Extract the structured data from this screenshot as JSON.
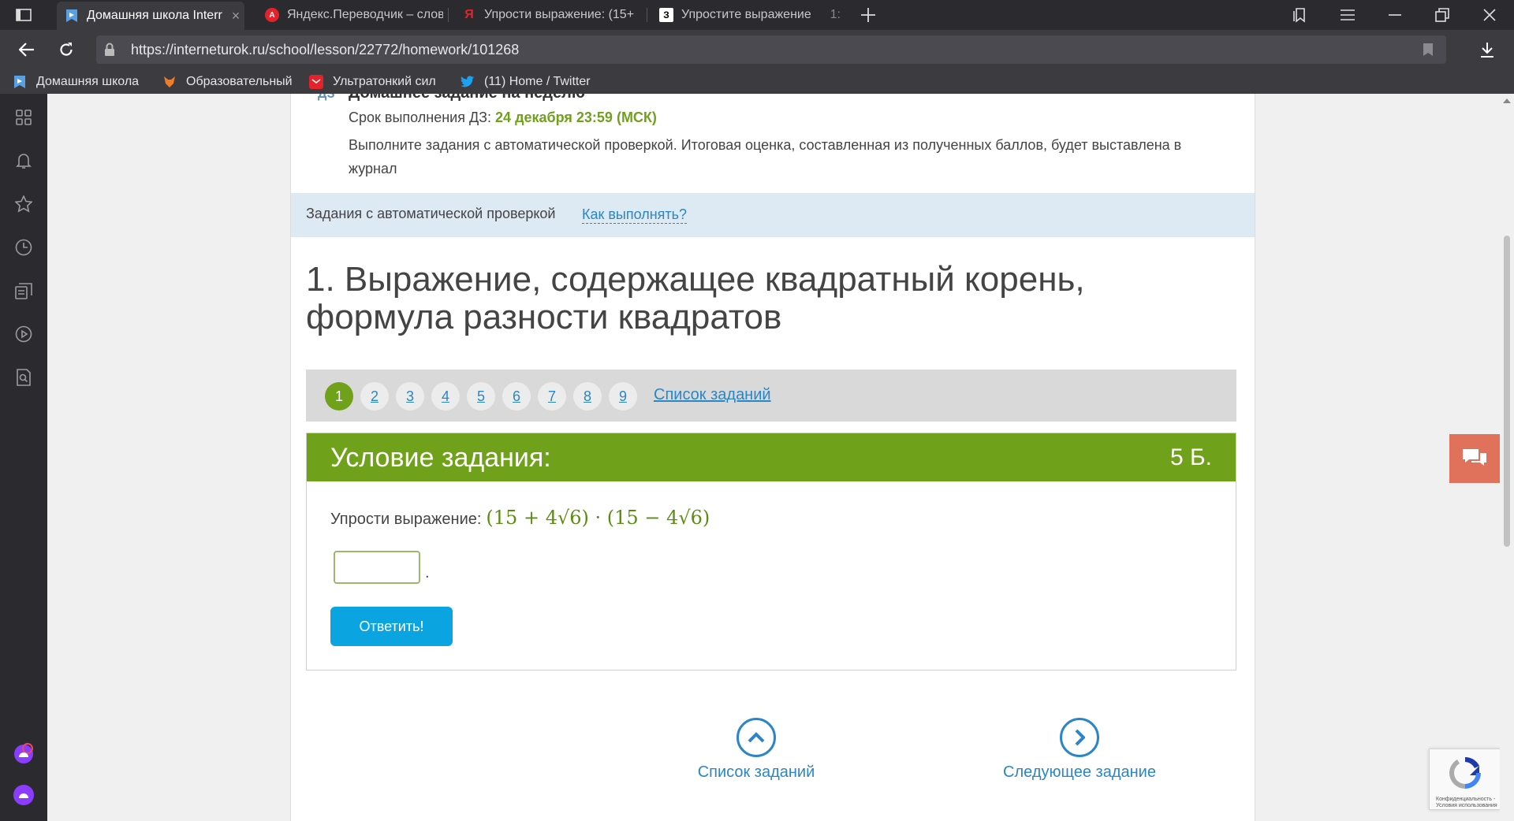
{
  "browser": {
    "tabs": [
      {
        "label": "Домашняя школа Interr",
        "active": true,
        "favicon": "interneturok"
      },
      {
        "label": "Яндекс.Переводчик – слов",
        "active": false,
        "favicon": "yandex-translate"
      },
      {
        "label": "Упрости выражение: (15+",
        "active": false,
        "favicon": "yandex"
      },
      {
        "label": "Упростите выражение",
        "active": false,
        "favicon": "znanija"
      }
    ],
    "tab_close": "×",
    "tab4_extra": "1:",
    "znanija_letter": "З",
    "yandex_letter": "Я",
    "url": "https://interneturok.ru/school/lesson/22772/homework/101268",
    "bookmarks": [
      {
        "label": "Домашняя школа"
      },
      {
        "label": "Образовательный"
      },
      {
        "label": "Ультратонкий сил"
      },
      {
        "label": "(11) Home / Twitter"
      }
    ]
  },
  "homework": {
    "badge": "ДЗ",
    "title": "Домашнее задание на неделю",
    "deadline_label": "Срок выполнения ДЗ:",
    "deadline_value": "24 декабря 23:59 (МСК)",
    "description": "Выполните задания с автоматической проверкой. Итоговая оценка, составленная из полученных баллов, будет выставлена в журнал"
  },
  "autobar": {
    "text": "Задания с автоматической проверкой",
    "link": "Как выполнять?"
  },
  "lesson": {
    "title": "1. Выражение, содержащее квадратный корень, формула разности квадратов"
  },
  "pager": {
    "pages": [
      "1",
      "2",
      "3",
      "4",
      "5",
      "6",
      "7",
      "8",
      "9"
    ],
    "active": "1",
    "list_link": "Список заданий"
  },
  "task": {
    "header": "Условие задания:",
    "points": "5 Б.",
    "question_label": "Упрости выражение:",
    "expression": "(15 + 4√6) · (15 − 4√6)",
    "answer_value": "",
    "answer_suffix": ".",
    "submit_label": "Ответить!"
  },
  "bottom_nav": {
    "list_label": "Список заданий",
    "next_label": "Следующее задание"
  },
  "recaptcha": {
    "text": "Конфиденциальность - Условия использования"
  },
  "colors": {
    "accent_green": "#6fa11b",
    "link_blue": "#2a86c6",
    "button_blue": "#0aa4e0",
    "chat_orange": "#e0715b"
  }
}
